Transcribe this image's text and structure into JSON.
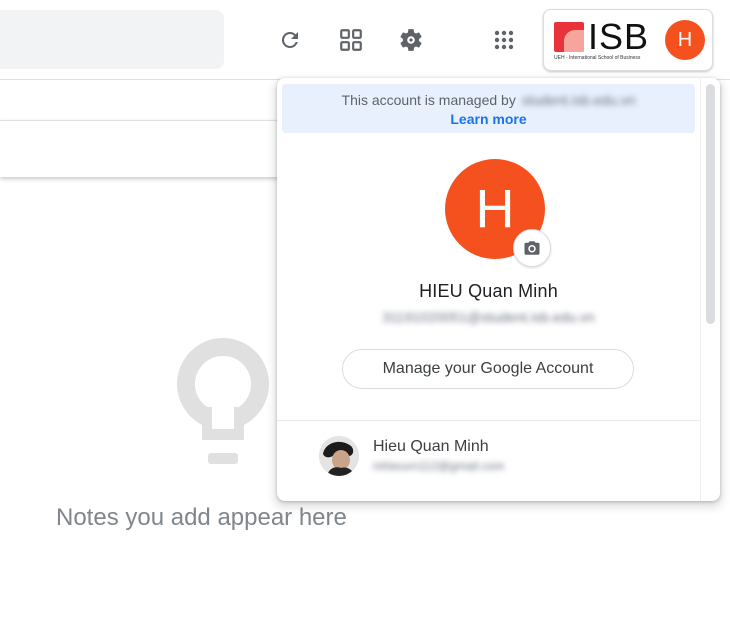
{
  "header": {
    "icons": [
      "refresh-icon",
      "grid-view-icon",
      "settings-icon",
      "apps-icon"
    ],
    "account_chip": {
      "logo_text": "ISB",
      "logo_subtext": "UEH - International School of Business",
      "avatar_initial": "H",
      "avatar_color": "#f4511e"
    }
  },
  "main": {
    "empty_state_text": "Notes you add appear here",
    "empty_state_icon": "lightbulb-icon"
  },
  "account_panel": {
    "managed_notice": "This account is managed by",
    "managed_domain": "student.isb.edu.vn",
    "learn_more": "Learn more",
    "avatar_initial": "H",
    "name": "HIEU Quan Minh",
    "email": "31191020051@student.isb.edu.vn",
    "manage_button": "Manage your Google Account",
    "other_accounts": [
      {
        "name": "Hieu Quan Minh",
        "email": "mhieuvn112@gmail.com"
      }
    ]
  },
  "colors": {
    "accent_blue": "#1a73e8",
    "avatar_orange": "#f4511e",
    "managed_banner_bg": "#e8f0fe"
  }
}
